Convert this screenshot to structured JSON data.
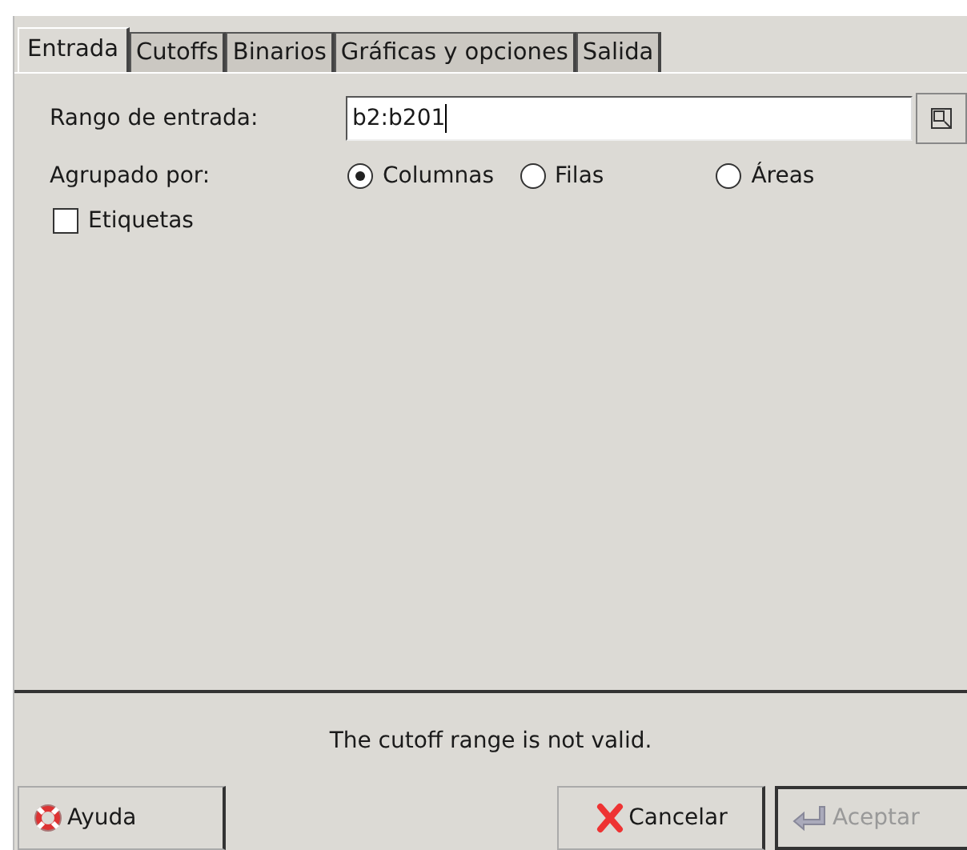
{
  "tabs": [
    {
      "label": "Entrada",
      "selected": true
    },
    {
      "label": "Cutoffs",
      "selected": false
    },
    {
      "label": "Binarios",
      "selected": false
    },
    {
      "label": "Gráficas y opciones",
      "selected": false
    },
    {
      "label": "Salida",
      "selected": false
    }
  ],
  "input_range": {
    "label": "Rango de entrada:",
    "value": "b2:b201"
  },
  "group_by": {
    "label": "Agrupado por:",
    "options": [
      {
        "label": "Columnas",
        "selected": true
      },
      {
        "label": "Filas",
        "selected": false
      },
      {
        "label": "Áreas",
        "selected": false
      }
    ]
  },
  "labels_checkbox": {
    "label": "Etiquetas",
    "checked": false
  },
  "message": "The cutoff range is not valid.",
  "buttons": [
    {
      "kind": "help",
      "label": "Ayuda",
      "disabled": false
    },
    {
      "kind": "cancel",
      "label": "Cancelar",
      "disabled": false
    },
    {
      "kind": "ok",
      "label": "Aceptar",
      "disabled": true
    }
  ]
}
